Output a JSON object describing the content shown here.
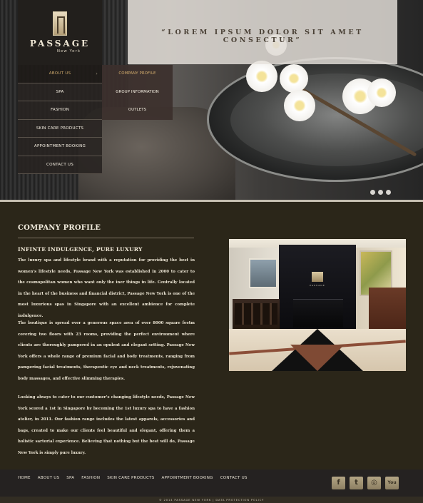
{
  "brand": {
    "name": "PASSAGE",
    "location": "New York",
    "tagline": "“LOREM IPSUM DOLOR SIT AMET CONSECTUR”"
  },
  "nav": {
    "items": [
      {
        "label": "ABOUT US",
        "active": true
      },
      {
        "label": "SPA"
      },
      {
        "label": "FASHION"
      },
      {
        "label": "SKIN CARE PRODUCTS"
      },
      {
        "label": "APPOINTMENT BOOKING"
      },
      {
        "label": "CONTACT US"
      }
    ],
    "submenu": [
      {
        "label": "COMPANY PROFILE",
        "active": true
      },
      {
        "label": "GROUP INFORMATION"
      },
      {
        "label": "OUTLETS"
      }
    ]
  },
  "slider": {
    "dot_count": 3
  },
  "content": {
    "title": "COMPANY PROFILE",
    "subtitle": "INFINTE INDULGENCE, PURE LUXURY",
    "paragraphs": [
      "The luxury spa and lifestyle brand with a reputation for providing the best in women’s lifestyle needs, Passage New York was established in 2000 to cater to the cosmopolitan women who want only the iner things in life. Centrally located in the heart of the business and financial district, Passage New York is one of the most luxurious spas in Singapore with an excellent ambience for complete indulgence.",
      "The boutique is spread over a generous space area of over 8000 square feetm covering two floors with 23 rooms, providing the perfect environment where clients are thoroughly pampered in an opulent and elegant setting. Passage New York offers a whole range of premium facial and body treatments, ranging from pampering facial treatments, therapeutic eye and neck treatments, rejuvenating body massages, and effective slimming therapies.",
      "Looking always to cater to our customer’s changing lifestyle needs, Passage New York scored a 1st in Singapore by becoming the 1st luxury spa to have a fashion atelier, in 2011. Our fashion range includes the latest apparels, accessories and bags, created to make our clients feel beautiful and elegant, offering them a holistic sartorial experience. Believing that nothing but the best will do, Passage New York is simply pure luxury."
    ],
    "photo_sign": "PASSAGE"
  },
  "footer": {
    "links": [
      "HOME",
      "ABOUT US",
      "SPA",
      "FASHION",
      "SKIN CARE PRODUCTS",
      "APPOINTMENT BOOKING",
      "CONTACT US"
    ],
    "social": [
      {
        "icon": "facebook-icon",
        "glyph": "f"
      },
      {
        "icon": "twitter-icon",
        "glyph": "t"
      },
      {
        "icon": "instagram-icon",
        "glyph": "◎"
      },
      {
        "icon": "youtube-icon",
        "glyph": "You"
      }
    ],
    "copyright": "© 2014 PASSAGE NEW YORK | DATA PROTECTION POLICY"
  },
  "colors": {
    "background": "#2b2619",
    "accent_gold": "#c8a56a",
    "footer": "#252221"
  }
}
